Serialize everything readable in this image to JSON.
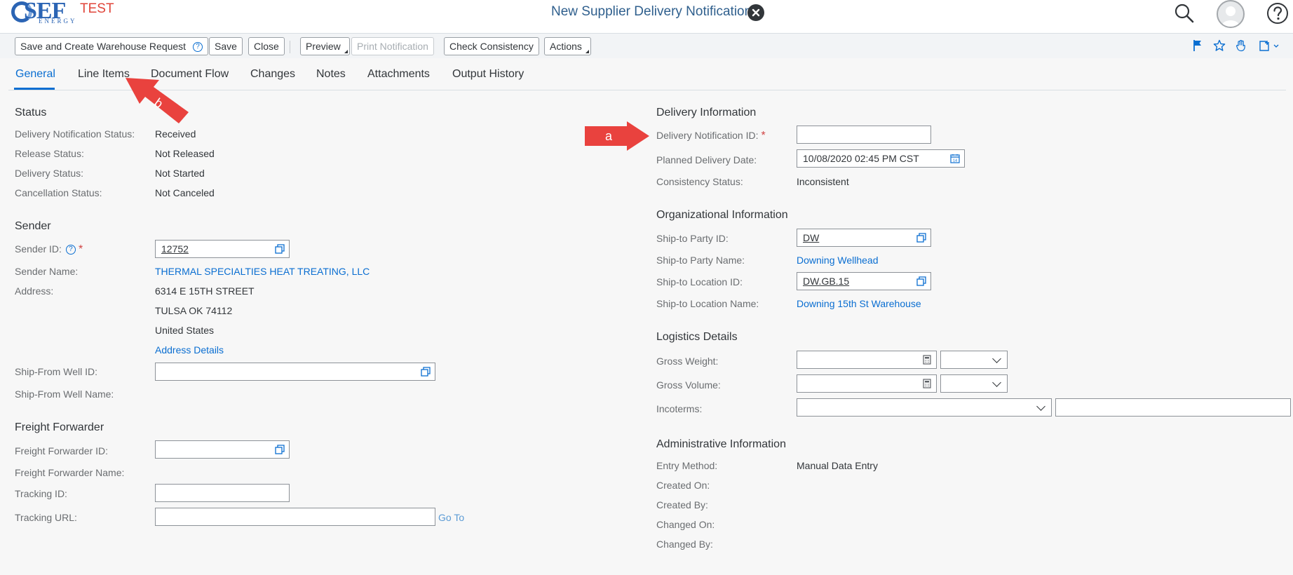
{
  "shell": {
    "logo_text": "SEF",
    "logo_sub": "ENERGY",
    "environment": "TEST",
    "title": "New Supplier Delivery Notification"
  },
  "toolbar": {
    "buttons": [
      {
        "label": "Save and Create Warehouse Request",
        "has_help": true
      },
      {
        "label": "Save"
      },
      {
        "label": "Close"
      },
      {
        "label": "Preview",
        "menu": true
      },
      {
        "label": "Print Notification",
        "disabled": true
      },
      {
        "label": "Check Consistency"
      },
      {
        "label": "Actions",
        "menu": true
      }
    ]
  },
  "tabs": [
    "General",
    "Line Items",
    "Document Flow",
    "Changes",
    "Notes",
    "Attachments",
    "Output History"
  ],
  "status": {
    "title": "Status",
    "rows": [
      {
        "label": "Delivery Notification Status:",
        "value": "Received"
      },
      {
        "label": "Release Status:",
        "value": "Not Released"
      },
      {
        "label": "Delivery Status:",
        "value": "Not Started"
      },
      {
        "label": "Cancellation Status:",
        "value": "Not Canceled"
      }
    ]
  },
  "sender": {
    "title": "Sender",
    "id_label": "Sender ID:",
    "id_value": "12752",
    "name_label": "Sender Name:",
    "name_value": "THERMAL SPECIALTIES HEAT TREATING, LLC",
    "address_label": "Address:",
    "address_lines": [
      "6314 E 15TH STREET",
      "TULSA OK  74112",
      "United States"
    ],
    "address_details": "Address Details",
    "well_id_label": "Ship-From Well ID:",
    "well_name_label": "Ship-From Well Name:"
  },
  "freight": {
    "title": "Freight Forwarder",
    "id_label": "Freight Forwarder ID:",
    "name_label": "Freight Forwarder Name:",
    "tracking_id_label": "Tracking ID:",
    "tracking_url_label": "Tracking URL:",
    "go_to": "Go To"
  },
  "delivery": {
    "title": "Delivery Information",
    "notif_id_label": "Delivery Notification ID:",
    "planned_date_label": "Planned Delivery Date:",
    "planned_date_value": "10/08/2020 02:45 PM CST",
    "consistency_label": "Consistency Status:",
    "consistency_value": "Inconsistent"
  },
  "org": {
    "title": "Organizational Information",
    "party_id_label": "Ship-to Party ID:",
    "party_id_value": "DW",
    "party_name_label": "Ship-to Party Name:",
    "party_name_value": "Downing Wellhead",
    "location_id_label": "Ship-to Location ID:",
    "location_id_value": "DW.GB.15",
    "location_name_label": "Ship-to Location Name:",
    "location_name_value": "Downing 15th St Warehouse"
  },
  "logistics": {
    "title": "Logistics Details",
    "gross_weight_label": "Gross Weight:",
    "gross_volume_label": "Gross Volume:",
    "incoterms_label": "Incoterms:"
  },
  "admin": {
    "title": "Administrative Information",
    "entry_method_label": "Entry Method:",
    "entry_method_value": "Manual Data Entry",
    "created_on_label": "Created On:",
    "created_by_label": "Created By:",
    "changed_on_label": "Changed On:",
    "changed_by_label": "Changed By:"
  },
  "annotations": {
    "a": "a",
    "b": "b"
  },
  "colors": {
    "accent": "#0a6ed1",
    "title": "#2f5f8d",
    "annotation": "#e9423e"
  }
}
